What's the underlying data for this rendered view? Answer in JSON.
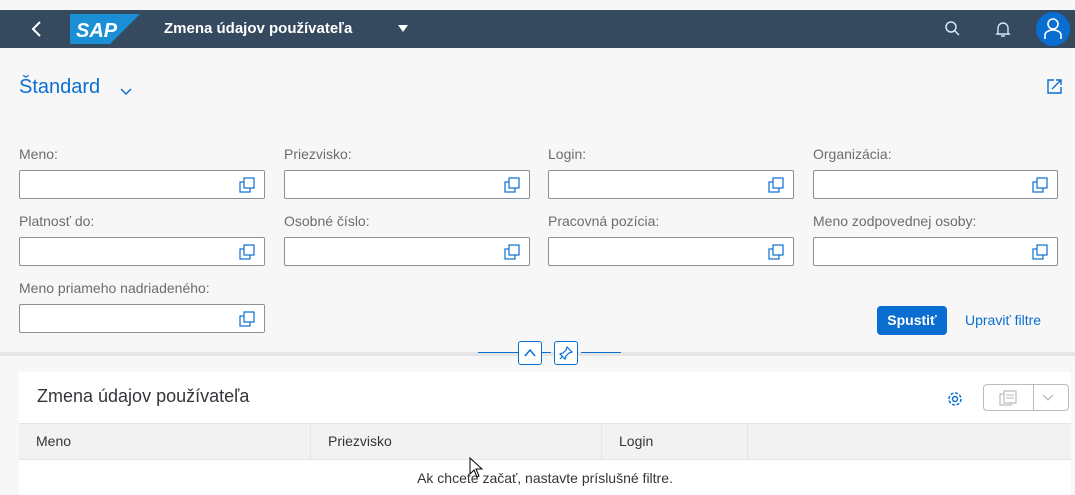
{
  "app": {
    "title": "Zmena údajov používateľa",
    "brand": "SAP",
    "colors": {
      "shell": "#354a5f",
      "accent": "#0a6ed1",
      "background": "#f7f7f7"
    }
  },
  "header": {
    "variant": "Štandard",
    "icons": [
      "back-icon",
      "search-icon",
      "bell-icon",
      "user-icon",
      "share-icon"
    ]
  },
  "filters": [
    {
      "label": "Meno:",
      "value": ""
    },
    {
      "label": "Priezvisko:",
      "value": ""
    },
    {
      "label": "Login:",
      "value": ""
    },
    {
      "label": "Organizácia:",
      "value": ""
    },
    {
      "label": "Platnosť do:",
      "value": ""
    },
    {
      "label": "Osobné číslo:",
      "value": ""
    },
    {
      "label": "Pracovná pozícia:",
      "value": ""
    },
    {
      "label": "Meno zodpovednej osoby:",
      "value": ""
    },
    {
      "label": "Meno priameho nadriadeného:",
      "value": ""
    }
  ],
  "actions": {
    "go": "Spustiť",
    "adapt": "Upraviť filtre"
  },
  "table": {
    "title": "Zmena údajov používateľa",
    "columns": [
      "Meno",
      "Priezvisko",
      "Login"
    ],
    "no_data": "Ak chcete začať, nastavte príslušné filtre."
  }
}
